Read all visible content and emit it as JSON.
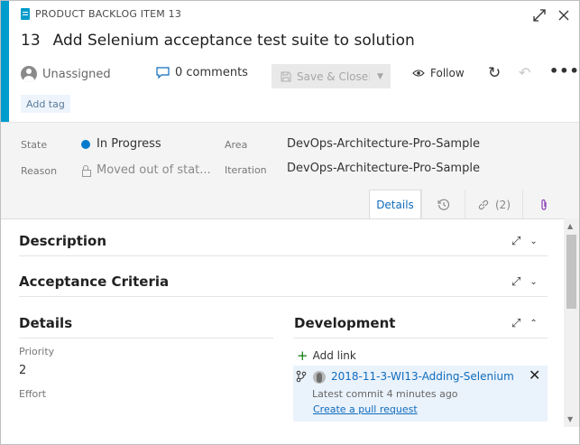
{
  "work_item": {
    "type_label": "PRODUCT BACKLOG ITEM 13",
    "id": "13",
    "title": "Add Selenium acceptance test suite to solution",
    "accent_color": "#009ccc"
  },
  "window": {
    "expand_icon": "expand-diagonal-icon",
    "close_icon": "close-icon"
  },
  "actions": {
    "assignee": "Unassigned",
    "comments": "0 comments",
    "save_label": "Save & Close",
    "follow_label": "Follow",
    "more_label": "•••"
  },
  "tags": {
    "add_tag": "Add tag"
  },
  "fields": {
    "state_label": "State",
    "state_value": "In Progress",
    "state_color": "#007acc",
    "reason_label": "Reason",
    "reason_value": "Moved out of stat...",
    "area_label": "Area",
    "area_value": "DevOps-Architecture-Pro-Sample",
    "iteration_label": "Iteration",
    "iteration_value": "DevOps-Architecture-Pro-Sample"
  },
  "tabs": {
    "details": "Details",
    "links_count": "(2)"
  },
  "sections": {
    "description": "Description",
    "acceptance": "Acceptance Criteria",
    "details": "Details",
    "development": "Development"
  },
  "details_fields": {
    "priority_label": "Priority",
    "priority_value": "2",
    "effort_label": "Effort"
  },
  "development": {
    "add_link": "Add link",
    "branch": "2018-11-3-WI13-Adding-Selenium",
    "commit": "Latest commit 4 minutes ago",
    "create_pr": "Create a pull request"
  }
}
